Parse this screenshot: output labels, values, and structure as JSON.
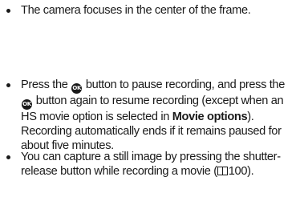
{
  "bullets": [
    {
      "text": "The camera focuses in the center of the frame."
    },
    {
      "part1": "Press the ",
      "ok_icon": "ok-button-icon",
      "ok_icon_text": "OK",
      "part2": " button to pause recording, and press the ",
      "part3": " button again to resume recording (except when an HS movie option is selected in ",
      "bold": "Movie options",
      "part4": "). Recording automatically ends if it remains paused for about five minutes."
    },
    {
      "part1": "You can capture a still image by pressing the shutter-release button while recording a movie (",
      "ref_icon": "book-reference-icon",
      "page": "100",
      "part2": ")."
    }
  ]
}
